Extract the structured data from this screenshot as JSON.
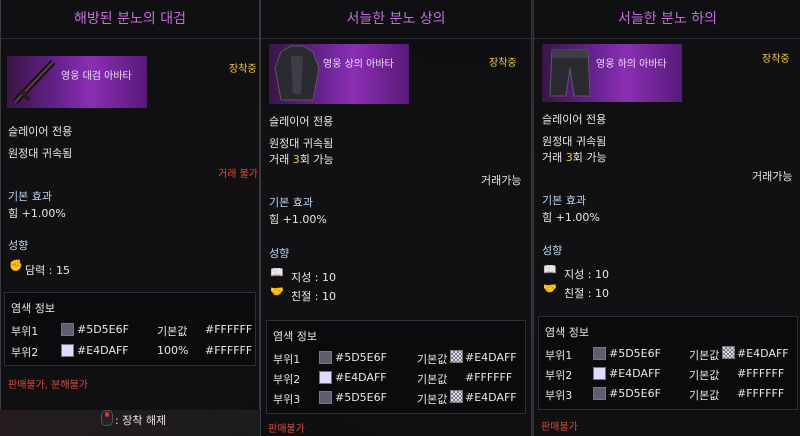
{
  "colors": {
    "title": "#c66be0",
    "equipped": "#f2c94c",
    "trade_red": "#d84a3a",
    "section_header": "#b9d4f0",
    "dye_1": "#5D5E6F",
    "dye_2": "#E4DAFF"
  },
  "panels": [
    {
      "title": "해방된 분노의 대검",
      "item_name": "영웅 대검 아바타",
      "equipped": "장착중",
      "class_only": "슬레이어 전용",
      "bound": "원정대 귀속됨",
      "trade": "거래 불가",
      "base_effect_header": "기본 효과",
      "base_effect": "힘 +1.00%",
      "tendency_header": "성향",
      "tendencies": [
        {
          "icon": "fist-icon",
          "text": "담력 : 15"
        }
      ],
      "dye_header": "염색 정보",
      "dye_rows": [
        {
          "part": "부위1",
          "color": "#5D5E6F",
          "base_label": "기본값",
          "base_value": "#FFFFFF"
        },
        {
          "part": "부위2",
          "color": "#E4DAFF",
          "base_label": "100%",
          "base_value": "#FFFFFF"
        }
      ],
      "sale_status_1": "판매불가",
      "sale_status_sep": ", ",
      "sale_status_2": "분해불가",
      "unequip_hint": ": 장착 해제"
    },
    {
      "title": "서늘한 분노 상의",
      "item_name": "영웅 상의 아바타",
      "equipped": "장착중",
      "class_only": "슬레이어 전용",
      "bound": "원정대 귀속됨",
      "trade_prefix": "거래 ",
      "trade_count": "3",
      "trade_suffix": "회 가능",
      "trade_status": "거래가능",
      "base_effect_header": "기본 효과",
      "base_effect": "힘 +1.00%",
      "tendency_header": "성향",
      "tendencies": [
        {
          "icon": "book-icon",
          "text": "지성 : 10"
        },
        {
          "icon": "handshake-icon",
          "text": "친절 : 10"
        }
      ],
      "dye_header": "염색 정보",
      "dye_rows": [
        {
          "part": "부위1",
          "color": "#5D5E6F",
          "base_label": "기본값",
          "base_value": "#E4DAFF"
        },
        {
          "part": "부위2",
          "color": "#E4DAFF",
          "base_label": "기본값",
          "base_value": "#FFFFFF"
        },
        {
          "part": "부위3",
          "color": "#5D5E6F",
          "base_label": "기본값",
          "base_value": "#E4DAFF"
        }
      ],
      "sale_status": "판매불가"
    },
    {
      "title": "서늘한 분노 하의",
      "item_name": "영웅 하의 아바타",
      "equipped": "장착중",
      "class_only": "슬레이어 전용",
      "bound": "원정대 귀속됨",
      "trade_prefix": "거래 ",
      "trade_count": "3",
      "trade_suffix": "회 가능",
      "trade_status": "거래가능",
      "base_effect_header": "기본 효과",
      "base_effect": "힘 +1.00%",
      "tendency_header": "성향",
      "tendencies": [
        {
          "icon": "book-icon",
          "text": "지성 : 10"
        },
        {
          "icon": "handshake-icon",
          "text": "친절 : 10"
        }
      ],
      "dye_header": "염색 정보",
      "dye_rows": [
        {
          "part": "부위1",
          "color": "#5D5E6F",
          "base_label": "기본값",
          "base_value": "#E4DAFF"
        },
        {
          "part": "부위2",
          "color": "#E4DAFF",
          "base_label": "기본값",
          "base_value": "#FFFFFF"
        },
        {
          "part": "부위3",
          "color": "#5D5E6F",
          "base_label": "기본값",
          "base_value": "#FFFFFF"
        }
      ],
      "sale_status": "판매불가"
    }
  ]
}
